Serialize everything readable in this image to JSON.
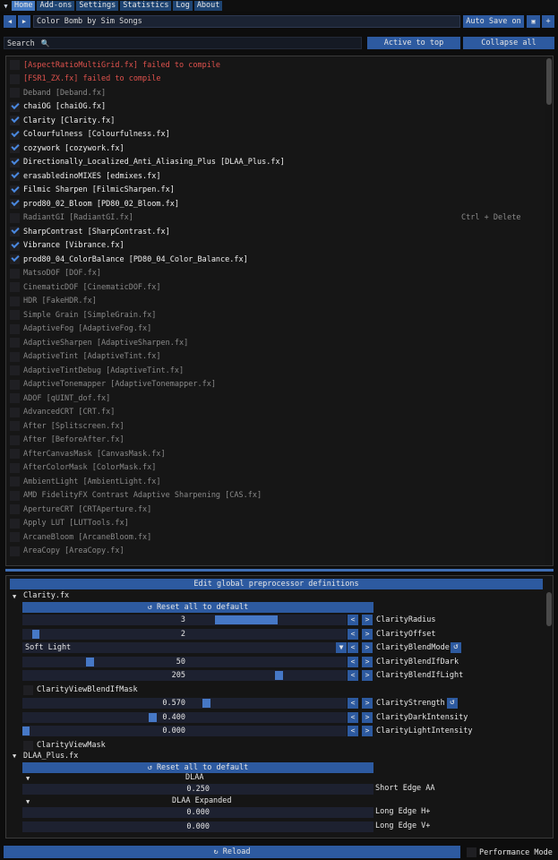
{
  "menu": {
    "tabs": [
      "Home",
      "Add-ons",
      "Settings",
      "Statistics",
      "Log",
      "About"
    ]
  },
  "preset": {
    "name": "Color Bomb by Sim Songs",
    "autosave": "Auto Save on",
    "prev": "◀",
    "next": "▶",
    "save": "💾",
    "add": "+"
  },
  "search": {
    "label": "Search",
    "active_top": "Active to top",
    "collapse": "Collapse all"
  },
  "effects": [
    {
      "label": "[AspectRatioMultiGrid.fx] failed to compile",
      "state": "err"
    },
    {
      "label": "[FSR1_ZX.fx] failed to compile",
      "state": "err"
    },
    {
      "label": "Deband [Deband.fx]",
      "state": "dis"
    },
    {
      "label": "chaiOG [chaiOG.fx]",
      "state": "on"
    },
    {
      "label": "Clarity [Clarity.fx]",
      "state": "on"
    },
    {
      "label": "Colourfulness [Colourfulness.fx]",
      "state": "on"
    },
    {
      "label": "cozywork [cozywork.fx]",
      "state": "on"
    },
    {
      "label": "Directionally_Localized_Anti_Aliasing_Plus [DLAA_Plus.fx]",
      "state": "on"
    },
    {
      "label": "erasabledinoMIXES [edmixes.fx]",
      "state": "on"
    },
    {
      "label": "Filmic Sharpen [FilmicSharpen.fx]",
      "state": "on"
    },
    {
      "label": "prod80_02_Bloom [PD80_02_Bloom.fx]",
      "state": "on"
    },
    {
      "label": "RadiantGI [RadiantGI.fx]",
      "state": "dis"
    },
    {
      "label": "SharpContrast [SharpContrast.fx]",
      "state": "on"
    },
    {
      "label": "Vibrance [Vibrance.fx]",
      "state": "on"
    },
    {
      "label": "prod80_04_ColorBalance [PD80_04_Color_Balance.fx]",
      "state": "on"
    },
    {
      "label": "MatsoDOF [DOF.fx]",
      "state": "dis"
    },
    {
      "label": "CinematicDOF [CinematicDOF.fx]",
      "state": "dis"
    },
    {
      "label": "HDR [FakeHDR.fx]",
      "state": "dis"
    },
    {
      "label": "Simple Grain [SimpleGrain.fx]",
      "state": "dis"
    },
    {
      "label": "AdaptiveFog [AdaptiveFog.fx]",
      "state": "dis"
    },
    {
      "label": "AdaptiveSharpen [AdaptiveSharpen.fx]",
      "state": "dis"
    },
    {
      "label": "AdaptiveTint [AdaptiveTint.fx]",
      "state": "dis"
    },
    {
      "label": "AdaptiveTintDebug [AdaptiveTint.fx]",
      "state": "dis"
    },
    {
      "label": "AdaptiveTonemapper [AdaptiveTonemapper.fx]",
      "state": "dis"
    },
    {
      "label": "ADOF [qUINT_dof.fx]",
      "state": "dis"
    },
    {
      "label": "AdvancedCRT [CRT.fx]",
      "state": "dis"
    },
    {
      "label": "After [Splitscreen.fx]",
      "state": "dis"
    },
    {
      "label": "After [BeforeAfter.fx]",
      "state": "dis"
    },
    {
      "label": "AfterCanvasMask [CanvasMask.fx]",
      "state": "dis"
    },
    {
      "label": "AfterColorMask [ColorMask.fx]",
      "state": "dis"
    },
    {
      "label": "AmbientLight [AmbientLight.fx]",
      "state": "dis"
    },
    {
      "label": "AMD FidelityFX Contrast Adaptive Sharpening [CAS.fx]",
      "state": "dis"
    },
    {
      "label": "ApertureCRT [CRTAperture.fx]",
      "state": "dis"
    },
    {
      "label": "Apply LUT [LUTTools.fx]",
      "state": "dis"
    },
    {
      "label": "ArcaneBloom [ArcaneBloom.fx]",
      "state": "dis"
    },
    {
      "label": "AreaCopy [AreaCopy.fx]",
      "state": "dis"
    }
  ],
  "hint": "Ctrl + Delete",
  "pp": {
    "title": "Edit global preprocessor definitions",
    "reset": "↺ Reset all to default",
    "clarity_header": "Clarity.fx",
    "dlaa_header": "DLAA_Plus.fx",
    "params": [
      {
        "value": "3",
        "name": "ClarityRadius",
        "fill": 0.47
      },
      {
        "value": "2",
        "name": "ClarityOffset",
        "fill": 0.03
      },
      {
        "value": "Soft Light",
        "name": "ClarityBlendMode",
        "combo": true
      },
      {
        "value": "50",
        "name": "ClarityBlendIfDark",
        "fill": 0.2
      },
      {
        "value": "205",
        "name": "ClarityBlendIfLight",
        "fill": 0.8
      },
      {
        "value": "ClarityViewBlendIfMask",
        "check": true
      },
      {
        "value": "0.570",
        "name": "ClarityStrength",
        "fill": 0.57
      },
      {
        "value": "0.400",
        "name": "ClarityDarkIntensity",
        "fill": 0.4
      },
      {
        "value": "0.000",
        "name": "ClarityLightIntensity",
        "fill": 0.0
      },
      {
        "value": "ClarityViewMask",
        "check": true
      }
    ],
    "dlaa_section": "DLAA",
    "dlaa_short_value": "0.250",
    "dlaa_short_name": "Short Edge AA",
    "dlaa_expanded": "DLAA Expanded",
    "dlaa_h_value": "0.000",
    "dlaa_h_name": "Long Edge H+",
    "dlaa_v_value": "0.000",
    "dlaa_v_name": "Long Edge V+"
  },
  "bottom": {
    "reload": "↻ Reload",
    "perf": "Performance Mode"
  }
}
